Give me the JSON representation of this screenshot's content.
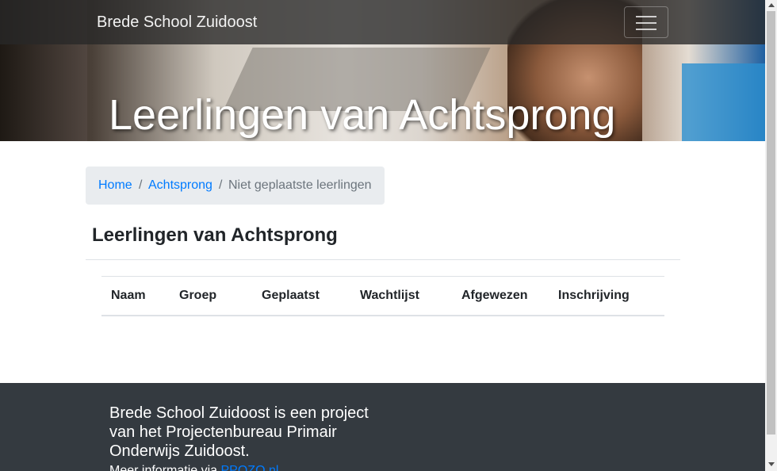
{
  "navbar": {
    "brand": "Brede School Zuidoost",
    "toggle_icon": "hamburger-icon"
  },
  "hero": {
    "title": "Leerlingen van Achtsprong"
  },
  "breadcrumb": {
    "items": [
      {
        "label": "Home"
      },
      {
        "label": "Achtsprong"
      },
      {
        "label": "Niet geplaatste leerlingen"
      }
    ],
    "separator": "/"
  },
  "main": {
    "title": "Leerlingen van Achtsprong",
    "table": {
      "headers": [
        "Naam",
        "Groep",
        "Geplaatst",
        "Wachtlijst",
        "Afgewezen",
        "Inschrijving"
      ],
      "rows": []
    }
  },
  "footer": {
    "text": "Brede School Zuidoost is een project van het Projectenbureau Primair Onderwijs Zuidoost.",
    "more_prefix": "Meer informatie via ",
    "more_link": "PPOZO.nl"
  },
  "colors": {
    "link": "#007bff",
    "navbar": "#282828",
    "footer": "#343a40",
    "breadcrumb_bg": "#e9ecef"
  }
}
